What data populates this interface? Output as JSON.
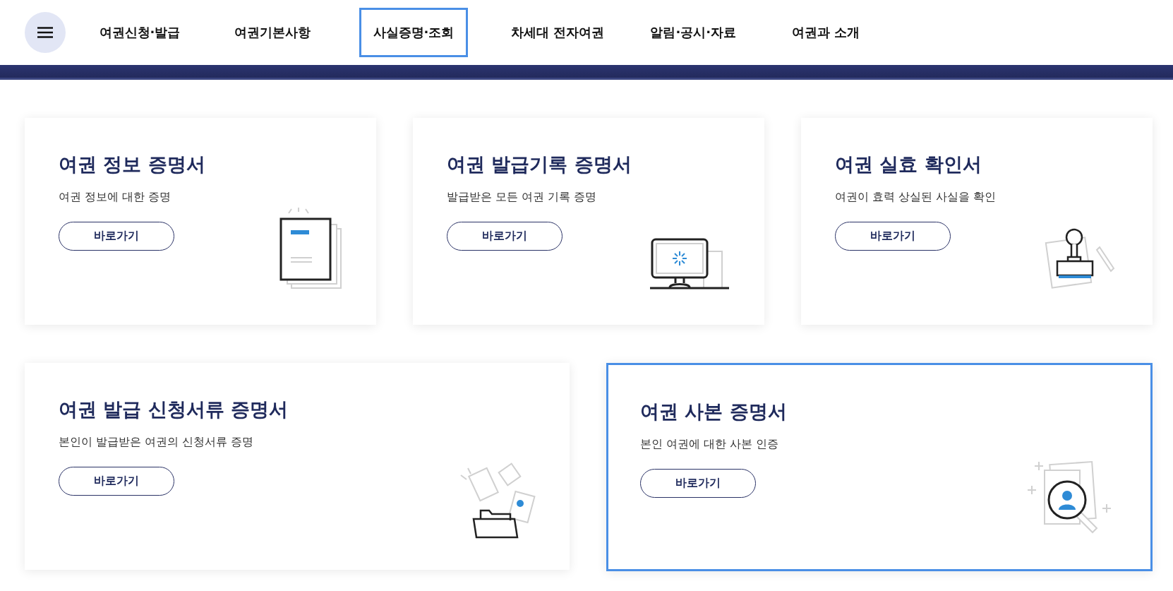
{
  "nav": {
    "items": [
      {
        "label": "여권신청·발급",
        "selected": false
      },
      {
        "label": "여권기본사항",
        "selected": false
      },
      {
        "label": "사실증명·조회",
        "selected": true
      },
      {
        "label": "차세대 전자여권",
        "selected": false
      },
      {
        "label": "알림·공시·자료",
        "selected": false
      },
      {
        "label": "여권과 소개",
        "selected": false
      }
    ]
  },
  "rows": [
    [
      {
        "title": "여권 정보 증명서",
        "description": "여권 정보에 대한 증명",
        "button": "바로가기",
        "kind": "document",
        "selected": false
      },
      {
        "title": "여권 발급기록 증명서",
        "description": "발급받은 모든 여권 기록 증명",
        "button": "바로가기",
        "kind": "computer",
        "selected": false
      },
      {
        "title": "여권 실효 확인서",
        "description": "여권이 효력 상실된 사실을 확인",
        "button": "바로가기",
        "kind": "stamp",
        "selected": false
      }
    ],
    [
      {
        "title": "여권 발급 신청서류 증명서",
        "description": "본인이 발급받은 여권의 신청서류 증명",
        "button": "바로가기",
        "kind": "folder",
        "selected": false
      },
      {
        "title": "여권 사본 증명서",
        "description": "본인 여권에 대한 사본 인증",
        "button": "바로가기",
        "kind": "magnifier",
        "selected": true
      }
    ]
  ]
}
